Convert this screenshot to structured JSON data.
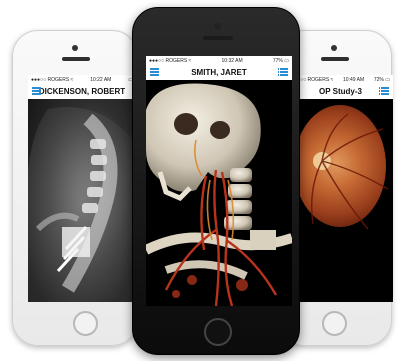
{
  "phones": {
    "left": {
      "status": {
        "carrier": "●●●○○ ROGERS ≈",
        "time": "10:22 AM",
        "battery": "▭"
      },
      "title": "DICKENSON, ROBERT",
      "image": "cervical-spine-xray"
    },
    "center": {
      "status": {
        "carrier": "●●●○○ ROGERS ≈",
        "time": "10:32 AM",
        "battery": "77% ▭"
      },
      "title": "SMITH, JARET",
      "image": "3d-skull-vascular-render"
    },
    "right": {
      "status": {
        "carrier": "●●●○○ ROGERS ≈",
        "time": "10:49 AM",
        "battery": "72% ▭"
      },
      "title": "OP Study-3",
      "image": "retinal-fundus-photo"
    }
  },
  "colors": {
    "accent": "#2a8dd4",
    "white_phone": "#f4f4f4",
    "black_phone": "#111111"
  }
}
